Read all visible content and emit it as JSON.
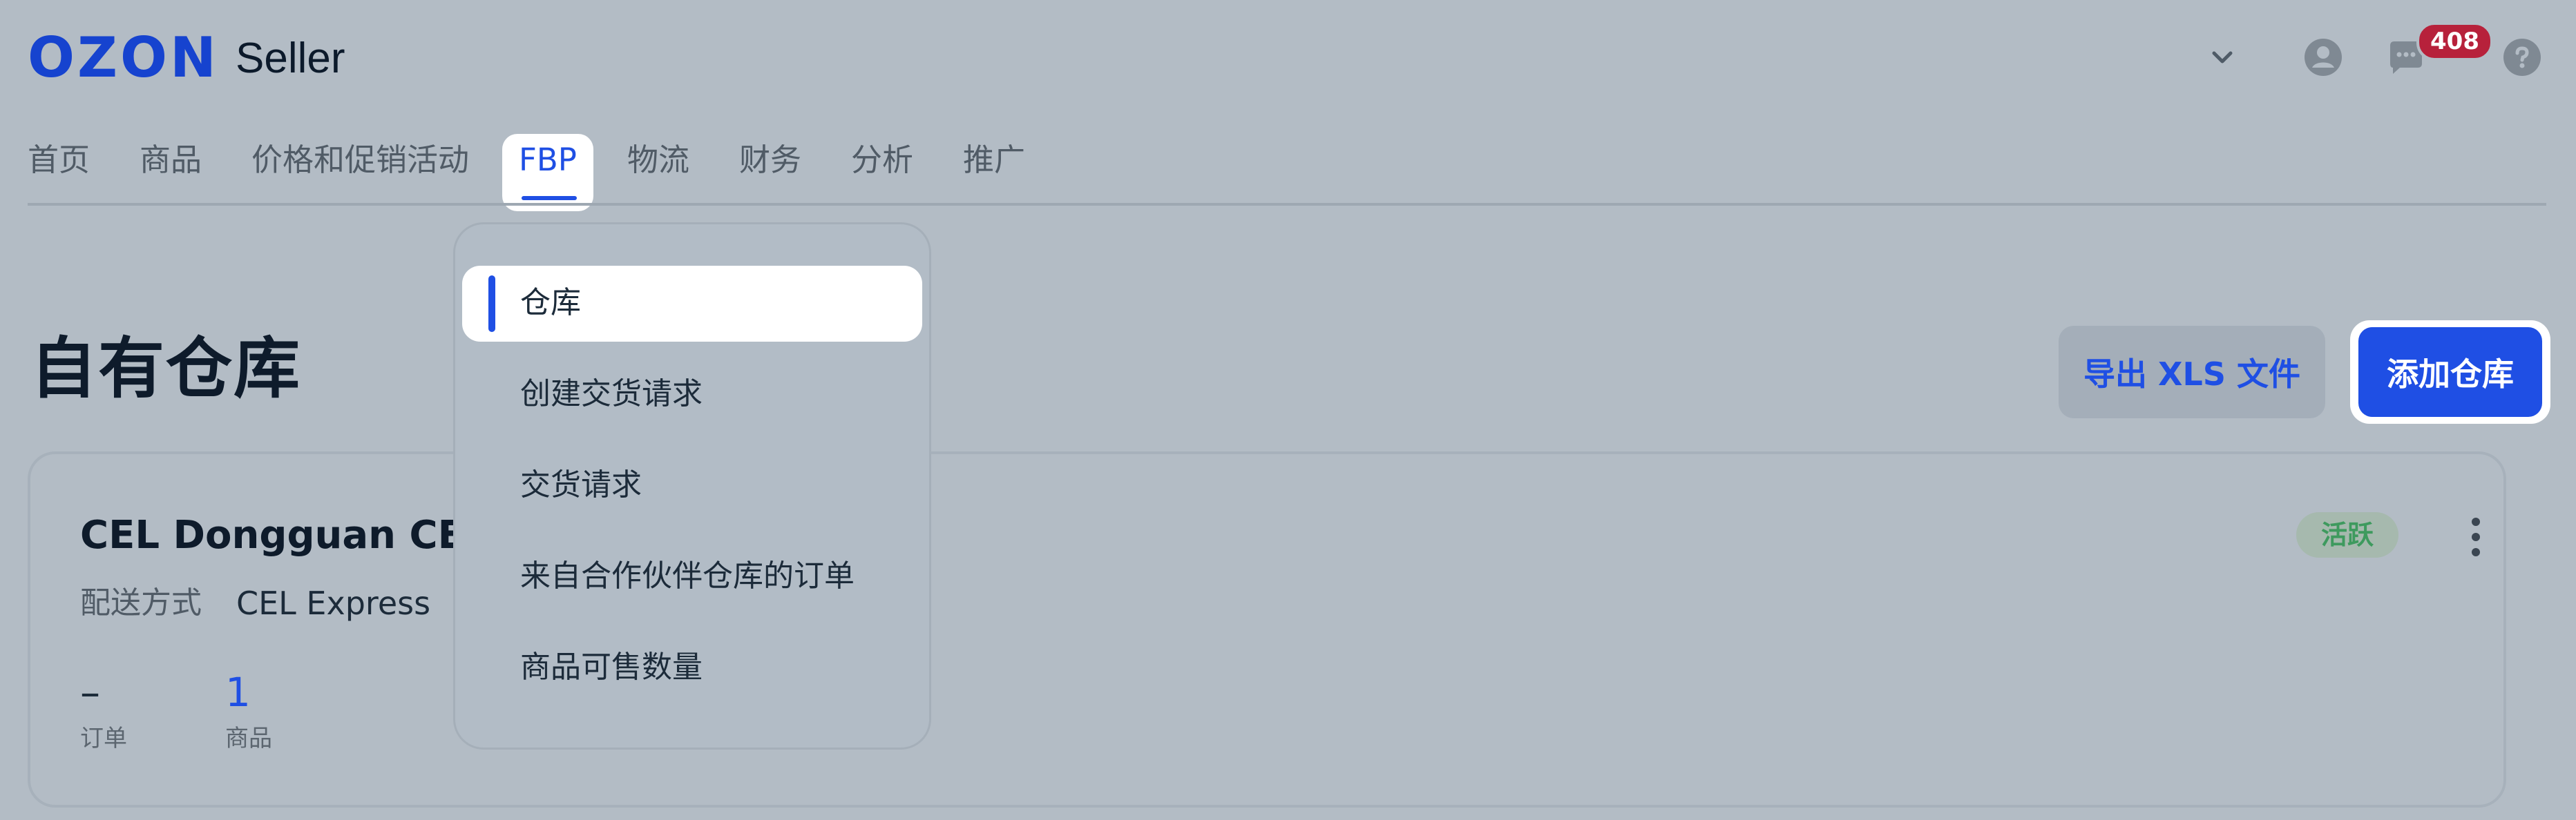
{
  "header": {
    "logo_main": "OZON",
    "logo_sub": "Seller",
    "notifications_count": "408"
  },
  "nav": {
    "items": [
      "首页",
      "商品",
      "价格和促销活动",
      "FBP",
      "物流",
      "财务",
      "分析",
      "推广"
    ],
    "active_index": 3
  },
  "dropdown": {
    "items": [
      "仓库",
      "创建交货请求",
      "交货请求",
      "来自合作伙伴仓库的订单",
      "商品可售数量"
    ],
    "active_index": 0
  },
  "page": {
    "title": "自有仓库",
    "export_button": "导出 XLS 文件",
    "add_button": "添加仓库"
  },
  "card": {
    "title": "CEL Dongguan CEL 2",
    "delivery_label": "配送方式",
    "delivery_value": "CEL Express",
    "status": "活跃",
    "stats": [
      {
        "value": "–",
        "label": "订单"
      },
      {
        "value": "1",
        "label": "商品"
      }
    ]
  },
  "colors": {
    "accent": "#1f4fe4",
    "brand": "#1643cf",
    "badge": "#b7213b",
    "status_green": "#3e9a5e",
    "overlay_bg": "#b3bcc5"
  }
}
